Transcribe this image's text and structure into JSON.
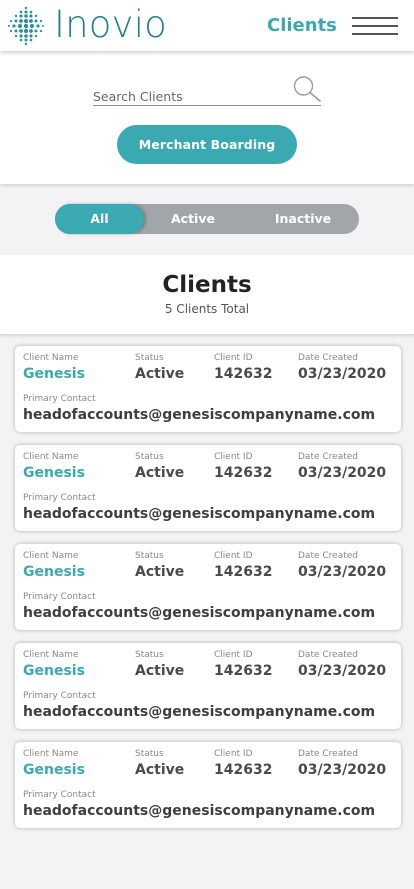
{
  "header": {
    "logo_text": "Inovio",
    "title": "Clients",
    "brand_color": "#3aa9b2",
    "menu_icon": "hamburger-menu-icon"
  },
  "search": {
    "placeholder": "Search Clients",
    "icon": "search-icon"
  },
  "boarding_button": {
    "label": "Merchant Boarding"
  },
  "filters": {
    "selected": "All",
    "tabs": [
      {
        "label": "All"
      },
      {
        "label": "Active"
      },
      {
        "label": "Inactive"
      }
    ]
  },
  "summary": {
    "title": "Clients",
    "count_text": "5 Clients Total"
  },
  "labels": {
    "client_name": "Client Name",
    "status": "Status",
    "client_id": "Client ID",
    "date_created": "Date Created",
    "primary_contact": "Primary Contact"
  },
  "clients": [
    {
      "name": "Genesis",
      "status": "Active",
      "id": "142632",
      "date": "03/23/2020",
      "contact": "headofaccounts@genesiscompanyname.com"
    },
    {
      "name": "Genesis",
      "status": "Active",
      "id": "142632",
      "date": "03/23/2020",
      "contact": "headofaccounts@genesiscompanyname.com"
    },
    {
      "name": "Genesis",
      "status": "Active",
      "id": "142632",
      "date": "03/23/2020",
      "contact": "headofaccounts@genesiscompanyname.com"
    },
    {
      "name": "Genesis",
      "status": "Active",
      "id": "142632",
      "date": "03/23/2020",
      "contact": "headofaccounts@genesiscompanyname.com"
    },
    {
      "name": "Genesis",
      "status": "Active",
      "id": "142632",
      "date": "03/23/2020",
      "contact": "headofaccounts@genesiscompanyname.com"
    }
  ]
}
